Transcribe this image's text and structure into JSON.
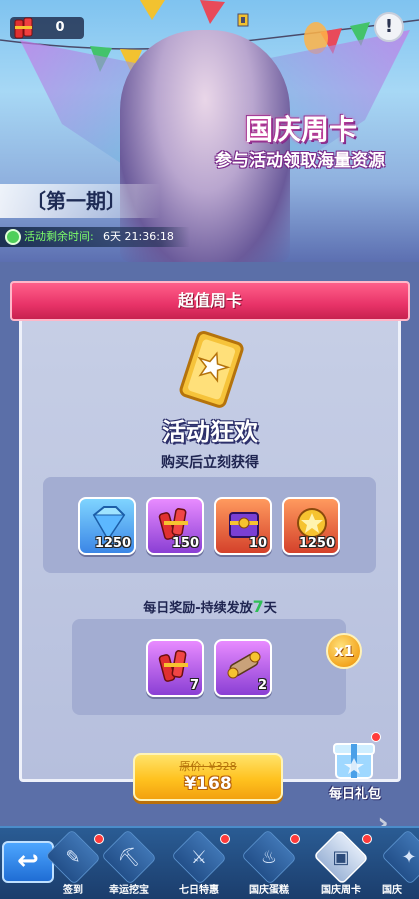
{
  "header": {
    "ticket_count": "0",
    "alert_label": "!"
  },
  "banner": {
    "title": "国庆周卡",
    "subtitle": "参与活动领取海量资源",
    "period": "〔第一期〕",
    "timer_label": "活动剩余时间:",
    "timer_value": "6天 21:36:18"
  },
  "card": {
    "ribbon_title": "超值周卡",
    "headline": "活动狂欢",
    "subheadline": "购买后立刻获得",
    "instant_rewards": [
      {
        "name": "diamond",
        "qty": "1250",
        "color": "#3b86e6"
      },
      {
        "name": "firecrackers",
        "qty": "150",
        "color": "#8a3fd4"
      },
      {
        "name": "treasure-box",
        "qty": "10",
        "color": "#d4412b"
      },
      {
        "name": "medal",
        "qty": "1250",
        "color": "#d4412b"
      }
    ],
    "daily_title_prefix": "每日奖励-持续发放",
    "daily_days": "7",
    "daily_title_suffix": "天",
    "daily_rewards": [
      {
        "name": "firecrackers",
        "qty": "7",
        "color": "#8a3fd4"
      },
      {
        "name": "scroll",
        "qty": "2",
        "color": "#8a3fd4"
      }
    ],
    "multiplier": "x1",
    "original_price": "原价: ¥328",
    "price": "¥168"
  },
  "gift": {
    "label": "每日礼包"
  },
  "tabs": [
    {
      "label": "签到",
      "glyph": "✎",
      "active": false,
      "dot": true
    },
    {
      "label": "幸运挖宝",
      "glyph": "⛏",
      "active": false,
      "dot": false
    },
    {
      "label": "七日特惠",
      "glyph": "⚔",
      "active": false,
      "dot": true
    },
    {
      "label": "国庆蛋糕",
      "glyph": "♨",
      "active": false,
      "dot": true
    },
    {
      "label": "国庆周卡",
      "glyph": "▣",
      "active": true,
      "dot": true
    },
    {
      "label": "国庆",
      "glyph": "✦",
      "active": false,
      "dot": false
    }
  ],
  "colors": {
    "accent_pink": "#e83368",
    "gold": "#ffc21f",
    "timer_green": "#7dff6a"
  }
}
